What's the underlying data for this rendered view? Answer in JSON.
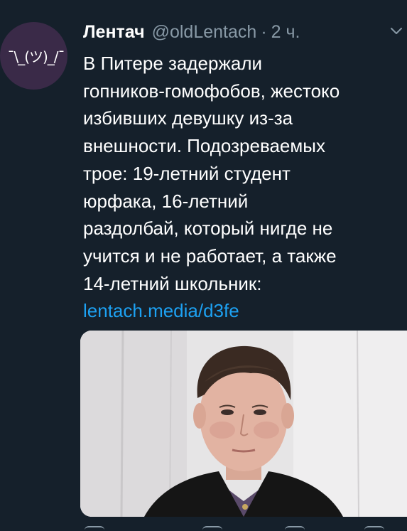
{
  "tweet": {
    "author": {
      "display_name": "Лентач",
      "handle": "@oldLentach",
      "separator": "·",
      "timestamp": "2 ч.",
      "avatar_text": "¯\\_(ツ)_/¯",
      "avatar_color": "#3a2a48"
    },
    "text_lines": [
      "В Питере задержали",
      "гопников-гомофобов, жестоко",
      "избивших девушку из-за",
      "внешности. Подозреваемых",
      "трое: 19-летний студент",
      "юрфака, 16-летний",
      "раздолбай, который нигде не",
      "учится и не работает, а также",
      "14-летний школьник:"
    ],
    "link": "lentach.media/d3fe",
    "menu_icon": "chevron-down-icon",
    "media_description_icon": "photo"
  },
  "theme": {
    "background": "#15202b",
    "text": "#ffffff",
    "secondary": "#8899a6",
    "link": "#1da1f2"
  }
}
